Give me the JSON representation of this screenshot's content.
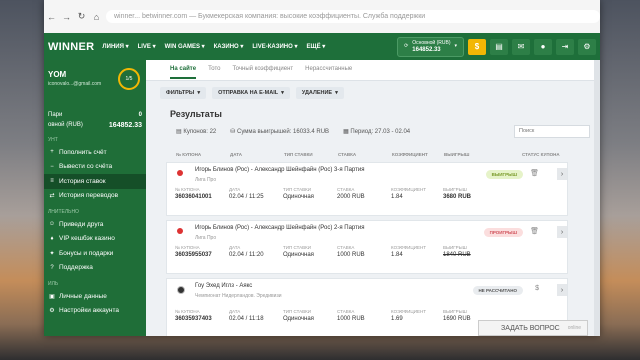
{
  "browser": {
    "url": "winner... betwinner.com — Букмекерская компания: высокие коэффициенты. Служба поддержки"
  },
  "nav": {
    "logo": "WINNER",
    "items": [
      "ЛИНИЯ ▾",
      "LIVE ▾",
      "WIN GAMES ▾",
      "КАЗИНО ▾",
      "LIVE-КАЗИНО ▾",
      "ЕЩЁ ▾"
    ],
    "balance_label": "Основной (RUB)",
    "balance_amount": "164852.33"
  },
  "sidebar": {
    "user_name": "YOM",
    "user_email": "iconovalo...@gmail.com",
    "level": "1/5",
    "bets_label": "Пари",
    "bets_value": "0",
    "balance_label": "овной (RUB)",
    "balance_value": "164852.33",
    "section1": "УНТ",
    "items1": [
      "Пополнить счёт",
      "Вывести со счёта",
      "История ставок",
      "История переводов"
    ],
    "section2": "ЛНИТЕЛЬНО",
    "items2": [
      "Приведи друга",
      "VIP кешбэк казино",
      "Бонусы и подарки",
      "Поддержка"
    ],
    "section3": "ИЛЬ",
    "items3": [
      "Личные данные",
      "Настройки аккаунта"
    ]
  },
  "tabs": [
    "На сайте",
    "Тото",
    "Точный коэффициент",
    "Нерассчитанные"
  ],
  "filters": [
    "ФИЛЬТРЫ",
    "ОТПРАВКА НА E-MAIL",
    "УДАЛЕНИЕ"
  ],
  "results": {
    "title": "Результаты",
    "coupons": "Купонов: 22",
    "winnings": "Сумма выигрышей: 16033.4 RUB",
    "period": "Период: 27.03 - 02.04",
    "search_placeholder": "Поиск"
  },
  "table_headers": [
    "№ КУПОНА",
    "ДАТА",
    "ТИП СТАВКИ",
    "СТАВКА",
    "КОЭФФИЦИЕНТ",
    "ВЫИГРЫШ",
    "СТАТУС КУПОНА"
  ],
  "row_labels": [
    "№ КУПОНА",
    "ДАТА",
    "ТИП СТАВКИ",
    "СТАВКА",
    "КОЭФФИЦИЕНТ",
    "ВЫИГРЫШ"
  ],
  "coupons": [
    {
      "match": "Игорь Блинов (Рос) - Александр Шейнфайн (Рос) 3-я Партия",
      "league": "Лига Про",
      "status": "ВЫИГРЫШ",
      "number": "36036041001",
      "date": "02.04 / 11:25",
      "type": "Одиночная",
      "stake": "2000 RUB",
      "coef": "1.84",
      "win": "3680 RUB"
    },
    {
      "match": "Игорь Блинов (Рос) - Александр Шейнфайн (Рос) 2-я Партия",
      "league": "Лига Про",
      "status": "ПРОИГРЫШ",
      "number": "36035955037",
      "date": "02.04 / 11:20",
      "type": "Одиночная",
      "stake": "1000 RUB",
      "coef": "1.84",
      "win": "1840 RUB"
    },
    {
      "match": "Гоу Эхед Иглз - Аякс",
      "league": "Чемпионат Нидерландов. Эредивизи",
      "status": "НЕ РАССЧИТАНО",
      "number": "36035937403",
      "date": "02.04 / 11:18",
      "type": "Одиночная",
      "stake": "1000 RUB",
      "coef": "1.69",
      "win": "1690 RUB"
    }
  ],
  "colors": {
    "brand": "#1e6f3a",
    "win": "#e6f3c9",
    "lose": "#fbdede",
    "pending": "#e9ecef"
  },
  "ask_question": "ЗАДАТЬ ВОПРОС",
  "ask_status": "online"
}
